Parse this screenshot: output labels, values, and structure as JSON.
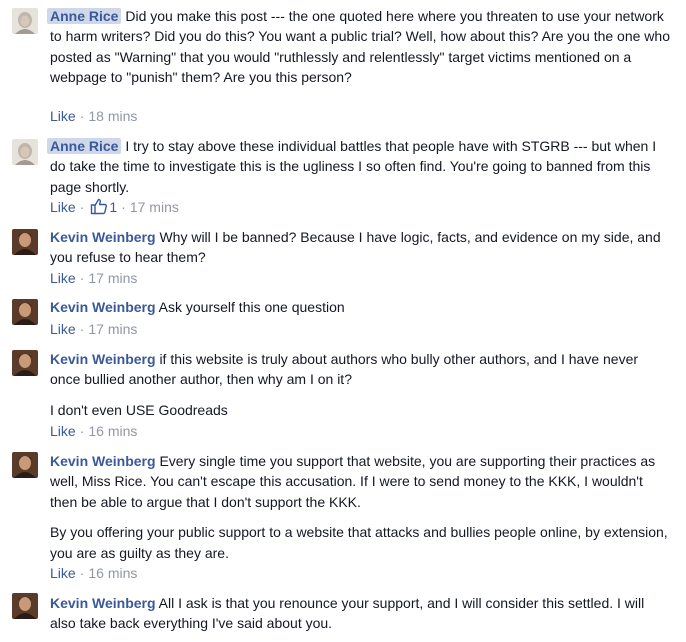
{
  "comments": [
    {
      "author": "Anne Rice",
      "paragraphs": [
        "Did you make this post --- the one quoted here where you threaten to use your network to harm writers? Did you do this? You want a public trial? Well, how about this? Are you the one who posted as \"Warning\" that you would \"ruthlessly and relentlessly\" target victims mentioned on a webpage to \"punish\" them? Are you this person?"
      ],
      "like_label": "Like",
      "time": "18 mins"
    },
    {
      "author": "Anne Rice",
      "paragraphs": [
        "I try to stay above these individual battles that people have with STGRB --- but when I do take the time to investigate this is the ugliness I so often find. You're going to banned from this page shortly."
      ],
      "like_label": "Like",
      "like_count": "1",
      "time": "17 mins"
    },
    {
      "author": "Kevin Weinberg",
      "paragraphs": [
        "Why will I be banned? Because I have logic, facts, and evidence on my side, and you refuse to hear them?"
      ],
      "like_label": "Like",
      "time": "17 mins"
    },
    {
      "author": "Kevin Weinberg",
      "paragraphs": [
        "Ask yourself this one question"
      ],
      "like_label": "Like",
      "time": "17 mins"
    },
    {
      "author": "Kevin Weinberg",
      "paragraphs": [
        "if this website is truly about authors who bully other authors, and I have never once bullied another author, then why am I on it?",
        "I don't even USE Goodreads"
      ],
      "like_label": "Like",
      "time": "16 mins"
    },
    {
      "author": "Kevin Weinberg",
      "paragraphs": [
        "Every single time you support that website, you are supporting their practices as well, Miss Rice. You can't escape this accusation. If I were to send money to the KKK, I wouldn't then be able to argue that I don't support the KKK.",
        "By you offering your public support to a website that attacks and bullies people online, by extension, you are as guilty as they are."
      ],
      "like_label": "Like",
      "time": "16 mins"
    },
    {
      "author": "Kevin Weinberg",
      "paragraphs": [
        "All I ask is that you renounce your support, and I will consider this settled. I will also take back everything I've said about you."
      ]
    }
  ],
  "colors": {
    "link": "#3b5998",
    "meta": "#9197a3",
    "text": "#141823",
    "author_highlight": "#cfd8ea"
  },
  "icons": {
    "like_count": "thumbs-up-icon"
  }
}
